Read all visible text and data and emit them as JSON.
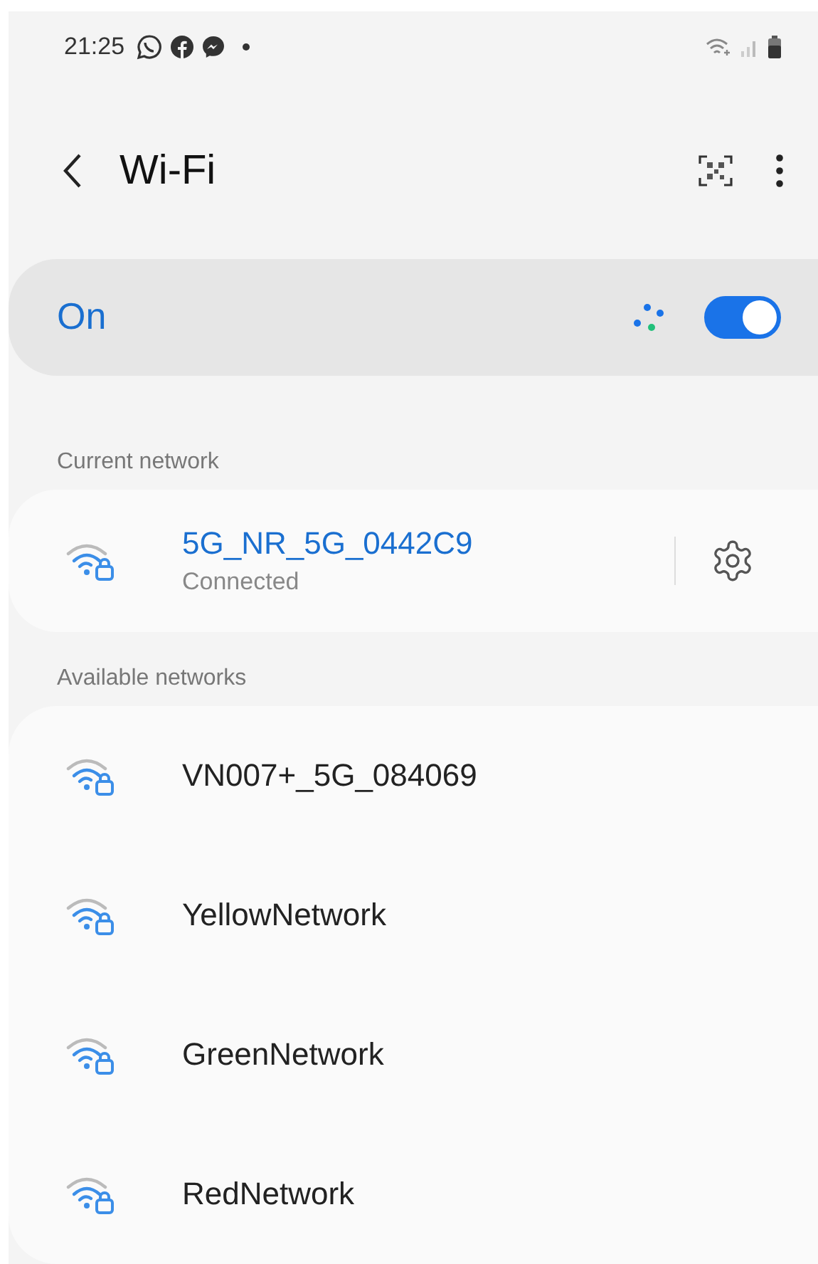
{
  "status_bar": {
    "time": "21:25"
  },
  "header": {
    "title": "Wi-Fi"
  },
  "wifi_switch": {
    "label": "On",
    "on": true
  },
  "current_network": {
    "heading": "Current network",
    "name": "5G_NR_5G_0442C9",
    "status": "Connected"
  },
  "available_networks": {
    "heading": "Available networks",
    "items": [
      {
        "name": "VN007+_5G_084069"
      },
      {
        "name": "YellowNetwork"
      },
      {
        "name": "GreenNetwork"
      },
      {
        "name": "RedNetwork"
      }
    ]
  }
}
